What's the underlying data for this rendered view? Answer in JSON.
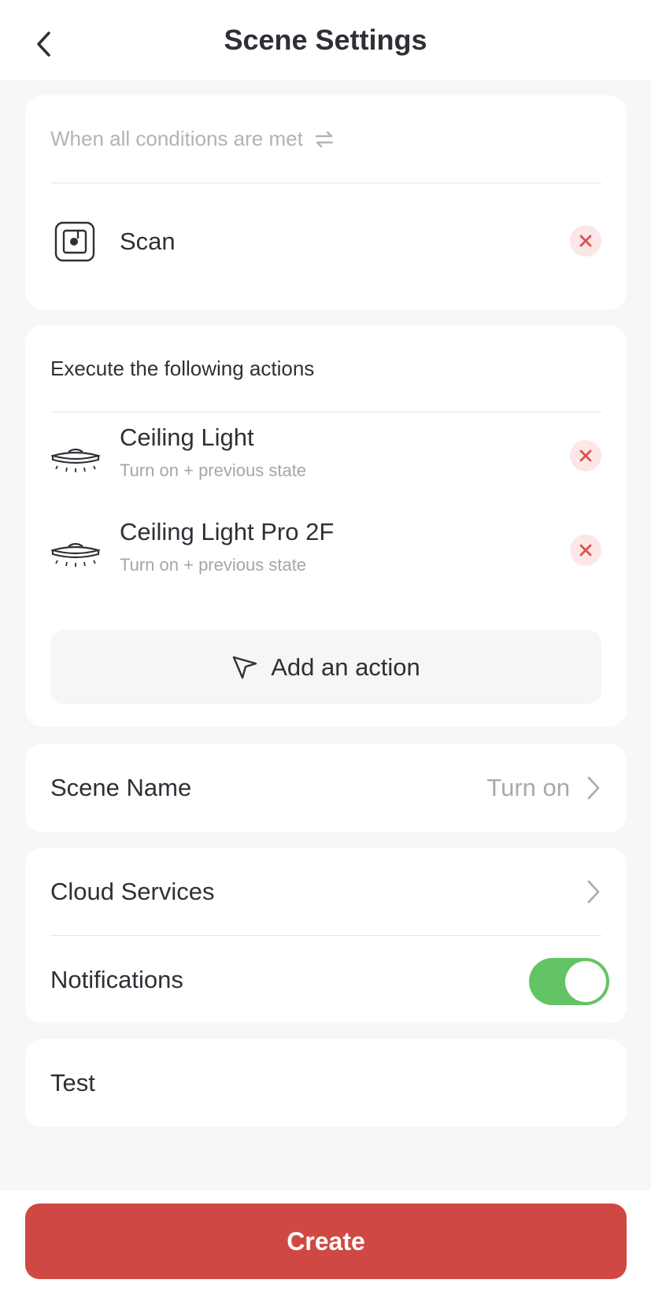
{
  "header": {
    "title": "Scene Settings",
    "back_icon": "chevron-left-icon"
  },
  "conditions": {
    "hint": "When all conditions are met",
    "hint_icon": "swap-arrows-icon",
    "items": [
      {
        "label": "Scan",
        "icon": "scan-icon"
      }
    ]
  },
  "actions": {
    "heading": "Execute the following actions",
    "items": [
      {
        "label": "Ceiling Light",
        "detail": "Turn on + previous state",
        "icon": "ceiling-light-icon"
      },
      {
        "label": "Ceiling Light Pro 2F",
        "detail": "Turn on + previous state",
        "icon": "ceiling-light-icon"
      }
    ],
    "add_label": "Add an action",
    "add_icon": "cursor-arrow-icon"
  },
  "scene_name": {
    "label": "Scene Name",
    "value": "Turn on"
  },
  "cloud_services": {
    "label": "Cloud Services"
  },
  "notifications": {
    "label": "Notifications",
    "enabled": true
  },
  "test": {
    "label": "Test"
  },
  "create_label": "Create",
  "colors": {
    "accent_red": "#d04843",
    "toggle_green": "#63c466",
    "remove_bg": "#fbe7e7",
    "remove_x": "#d9534f"
  }
}
